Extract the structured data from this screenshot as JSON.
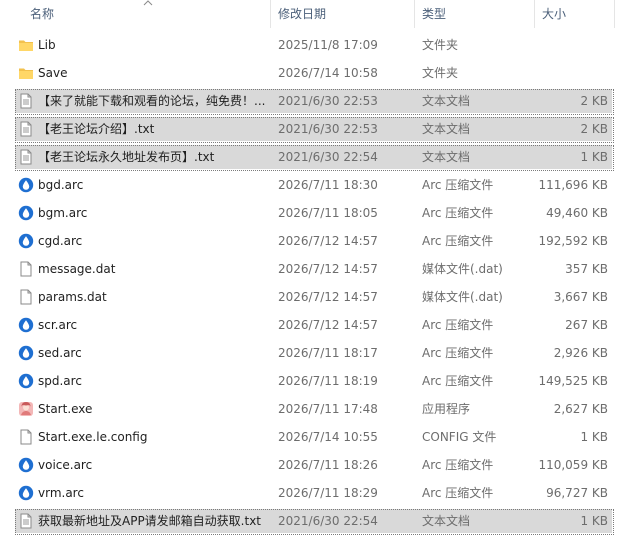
{
  "header": {
    "name": "名称",
    "date": "修改日期",
    "type": "类型",
    "size": "大小"
  },
  "files": [
    {
      "name": "Lib",
      "date": "2025/11/8 17:09",
      "type": "文件夹",
      "size": "",
      "icon": "folder-icon",
      "selected": false
    },
    {
      "name": "Save",
      "date": "2026/7/14 10:58",
      "type": "文件夹",
      "size": "",
      "icon": "folder-icon",
      "selected": false
    },
    {
      "name": "【来了就能下载和观看的论坛，纯免费！...",
      "date": "2021/6/30 22:53",
      "type": "文本文档",
      "size": "2 KB",
      "icon": "text-file-icon",
      "selected": true
    },
    {
      "name": "【老王论坛介绍】.txt",
      "date": "2021/6/30 22:53",
      "type": "文本文档",
      "size": "2 KB",
      "icon": "text-file-icon",
      "selected": true
    },
    {
      "name": "【老王论坛永久地址发布页】.txt",
      "date": "2021/6/30 22:54",
      "type": "文本文档",
      "size": "1 KB",
      "icon": "text-file-icon",
      "selected": true
    },
    {
      "name": "bgd.arc",
      "date": "2026/7/11 18:30",
      "type": "Arc 压缩文件",
      "size": "111,696 KB",
      "icon": "arc-file-icon",
      "selected": false
    },
    {
      "name": "bgm.arc",
      "date": "2026/7/11 18:05",
      "type": "Arc 压缩文件",
      "size": "49,460 KB",
      "icon": "arc-file-icon",
      "selected": false
    },
    {
      "name": "cgd.arc",
      "date": "2026/7/12 14:57",
      "type": "Arc 压缩文件",
      "size": "192,592 KB",
      "icon": "arc-file-icon",
      "selected": false
    },
    {
      "name": "message.dat",
      "date": "2026/7/12 14:57",
      "type": "媒体文件(.dat)",
      "size": "357 KB",
      "icon": "blank-file-icon",
      "selected": false
    },
    {
      "name": "params.dat",
      "date": "2026/7/12 14:57",
      "type": "媒体文件(.dat)",
      "size": "3,667 KB",
      "icon": "blank-file-icon",
      "selected": false
    },
    {
      "name": "scr.arc",
      "date": "2026/7/12 14:57",
      "type": "Arc 压缩文件",
      "size": "267 KB",
      "icon": "arc-file-icon",
      "selected": false
    },
    {
      "name": "sed.arc",
      "date": "2026/7/11 18:17",
      "type": "Arc 压缩文件",
      "size": "2,926 KB",
      "icon": "arc-file-icon",
      "selected": false
    },
    {
      "name": "spd.arc",
      "date": "2026/7/11 18:19",
      "type": "Arc 压缩文件",
      "size": "149,525 KB",
      "icon": "arc-file-icon",
      "selected": false
    },
    {
      "name": "Start.exe",
      "date": "2026/7/11 17:48",
      "type": "应用程序",
      "size": "2,627 KB",
      "icon": "app-icon",
      "selected": false
    },
    {
      "name": "Start.exe.le.config",
      "date": "2026/7/14 10:55",
      "type": "CONFIG 文件",
      "size": "1 KB",
      "icon": "blank-file-icon",
      "selected": false
    },
    {
      "name": "voice.arc",
      "date": "2026/7/11 18:26",
      "type": "Arc 压缩文件",
      "size": "110,059 KB",
      "icon": "arc-file-icon",
      "selected": false
    },
    {
      "name": "vrm.arc",
      "date": "2026/7/11 18:29",
      "type": "Arc 压缩文件",
      "size": "96,727 KB",
      "icon": "arc-file-icon",
      "selected": false
    },
    {
      "name": "获取最新地址及APP请发邮箱自动获取.txt",
      "date": "2021/6/30 22:54",
      "type": "文本文档",
      "size": "1 KB",
      "icon": "text-file-icon",
      "selected": true
    }
  ]
}
